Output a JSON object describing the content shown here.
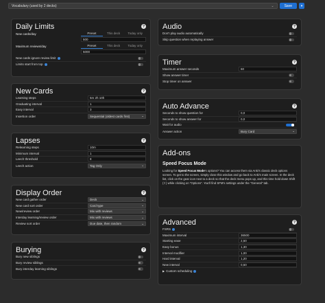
{
  "topbar": {
    "preset": "Vocabulary (used by 2 decks)",
    "save_label": "Save",
    "dropdown_arrow": "▾"
  },
  "daily_limits": {
    "title": "Daily Limits",
    "tabs": [
      "Preset",
      "This deck",
      "Today only"
    ],
    "new_cards_label": "New cards/day",
    "new_cards_value": "500",
    "max_reviews_label": "Maximum reviews/day",
    "max_reviews_value": "5000",
    "ignore_limit_label": "New cards ignore review limit",
    "limits_start_top_label": "Limits start from top"
  },
  "new_cards": {
    "title": "New Cards",
    "rows": [
      {
        "label": "Learning steps",
        "value": "5m 2h 10h"
      },
      {
        "label": "Graduating interval",
        "value": "1"
      },
      {
        "label": "Easy interval",
        "value": "3"
      },
      {
        "label": "Insertion order",
        "value": "Sequential (oldest cards first)"
      }
    ]
  },
  "lapses": {
    "title": "Lapses",
    "rows": [
      {
        "label": "Relearning steps",
        "value": "10m"
      },
      {
        "label": "Minimum interval",
        "value": "1"
      },
      {
        "label": "Leech threshold",
        "value": "8"
      },
      {
        "label": "Leech action",
        "value": "Tag Only"
      }
    ]
  },
  "display_order": {
    "title": "Display Order",
    "rows": [
      {
        "label": "New card gather order",
        "value": "Deck"
      },
      {
        "label": "New card sort order",
        "value": "Card type"
      },
      {
        "label": "New/review order",
        "value": "Mix with reviews"
      },
      {
        "label": "Interday learning/review order",
        "value": "Mix with reviews"
      },
      {
        "label": "Review sort order",
        "value": "Due date, then random"
      }
    ]
  },
  "burying": {
    "title": "Burying",
    "rows": [
      {
        "label": "Bury new siblings"
      },
      {
        "label": "Bury review siblings"
      },
      {
        "label": "Bury interday learning siblings"
      }
    ]
  },
  "audio": {
    "title": "Audio",
    "rows": [
      {
        "label": "Don't play audio automatically"
      },
      {
        "label": "Skip question when replaying answer"
      }
    ]
  },
  "timer": {
    "title": "Timer",
    "max_answer_label": "Maximum answer seconds",
    "max_answer_value": "60",
    "show_timer_label": "Show answer timer",
    "stop_timer_label": "Stop timer on answer"
  },
  "auto_advance": {
    "title": "Auto Advance",
    "q_seconds_label": "Seconds to show question for",
    "q_seconds_value": "0,0",
    "a_seconds_label": "Seconds to show answer for",
    "a_seconds_value": "0,0",
    "wait_audio_label": "Wait for audio",
    "answer_action_label": "Answer action",
    "answer_action_value": "Bury Card"
  },
  "addons": {
    "title": "Add-ons",
    "subtitle": "Speed Focus Mode",
    "text_before": "Looking for ",
    "text_bold": "Speed Focus Mode",
    "text_after": "'s options? You can access them via Anki's classic deck options screen. To get to the screen, simply close this window and go back to Anki's main screen. In the deck list, click on the gear icon next to a deck so that the deck menu pops up, and this time hold down Shift (⇧) while clicking on \"Options\". You'll find SFM's settings under the \"General\" tab."
  },
  "advanced": {
    "title": "Advanced",
    "fsrs_label": "FSRS",
    "rows": [
      {
        "label": "Maximum interval",
        "value": "36500"
      },
      {
        "label": "Starting ease",
        "value": "2,50"
      },
      {
        "label": "Easy bonus",
        "value": "1,30"
      },
      {
        "label": "Interval modifier",
        "value": "1,00"
      },
      {
        "label": "Hard interval",
        "value": "1,20"
      },
      {
        "label": "New interval",
        "value": "0,50"
      }
    ],
    "custom_scheduling_label": "Custom scheduling"
  },
  "help_glyph": "?",
  "chevron_glyph": "⌄",
  "triangle_glyph": "▶",
  "colors": {
    "accent": "#1f6fd1",
    "card_bg": "#1e1e1e",
    "page_bg": "#2c2c2c"
  }
}
